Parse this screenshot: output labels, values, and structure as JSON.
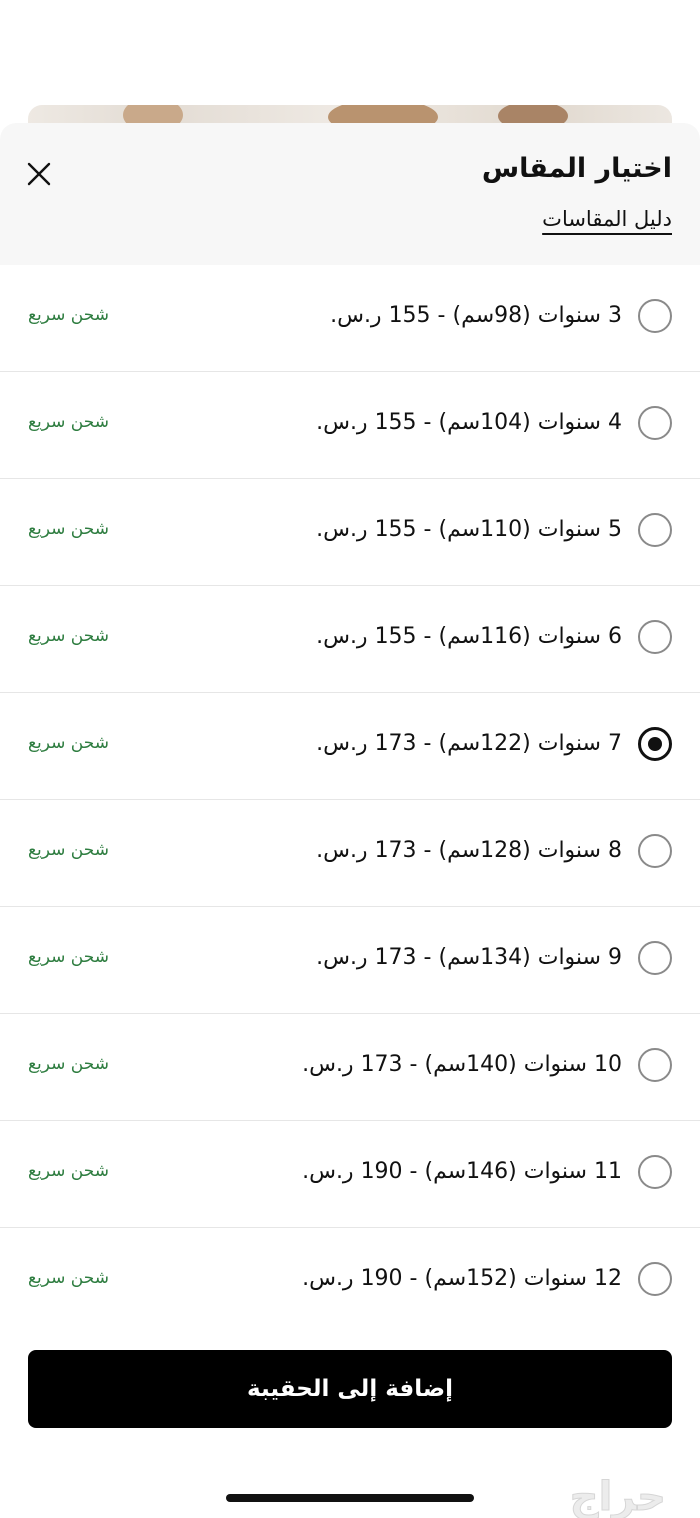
{
  "sheet": {
    "title": "اختيار المقاس",
    "size_guide_link": "دليل المقاسات",
    "close_icon": "close-icon"
  },
  "sizes": [
    {
      "label": "3 سنوات (98سم) - 155 ر.س.",
      "shipping": "شحن سريع",
      "selected": false
    },
    {
      "label": "4 سنوات (104سم) - 155 ر.س.",
      "shipping": "شحن سريع",
      "selected": false
    },
    {
      "label": "5 سنوات (110سم) - 155 ر.س.",
      "shipping": "شحن سريع",
      "selected": false
    },
    {
      "label": "6 سنوات (116سم) - 155 ر.س.",
      "shipping": "شحن سريع",
      "selected": false
    },
    {
      "label": "7 سنوات (122سم) - 173 ر.س.",
      "shipping": "شحن سريع",
      "selected": true
    },
    {
      "label": "8 سنوات (128سم) - 173 ر.س.",
      "shipping": "شحن سريع",
      "selected": false
    },
    {
      "label": "9 سنوات (134سم) - 173 ر.س.",
      "shipping": "شحن سريع",
      "selected": false
    },
    {
      "label": "10 سنوات (140سم) - 173 ر.س.",
      "shipping": "شحن سريع",
      "selected": false
    },
    {
      "label": "11 سنوات (146سم) - 190 ر.س.",
      "shipping": "شحن سريع",
      "selected": false
    },
    {
      "label": "12 سنوات (152سم) - 190 ر.س.",
      "shipping": "شحن سريع",
      "selected": false
    }
  ],
  "add_to_bag_label": "إضافة إلى الحقيبة",
  "watermark": "حراج",
  "colors": {
    "shipping_green": "#2e7d40",
    "button_bg": "#000000",
    "header_bg": "#f7f7f7"
  }
}
